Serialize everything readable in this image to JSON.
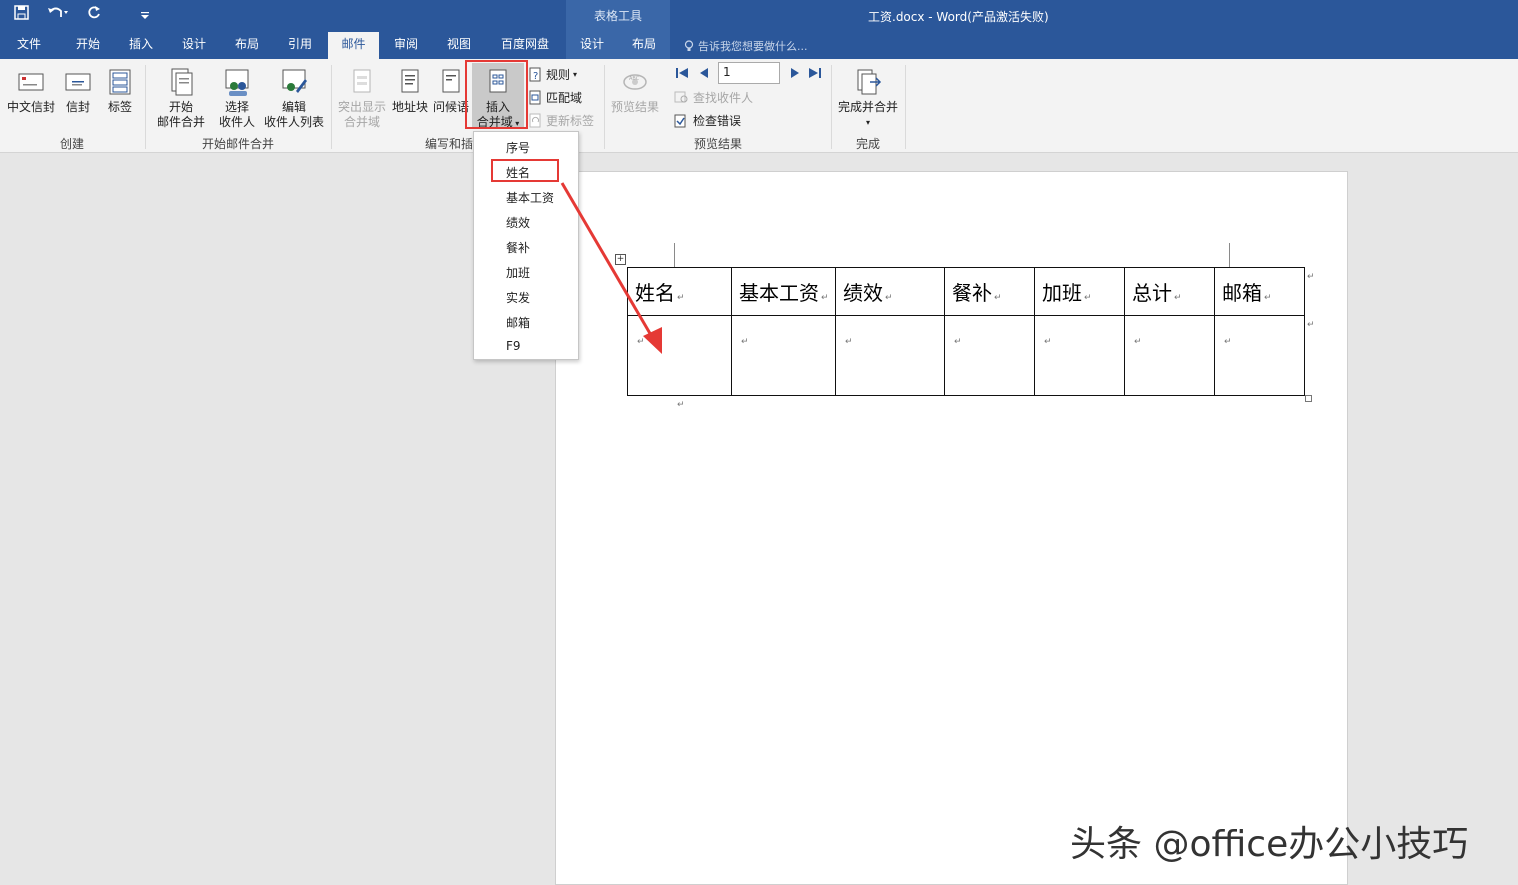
{
  "window": {
    "title": "工资.docx - Word(产品激活失败)",
    "context_tools": "表格工具"
  },
  "qat": {
    "save": "save-icon",
    "undo": "undo-icon",
    "redo": "redo-icon",
    "customize": "customize-icon"
  },
  "tabs": {
    "file": "文件",
    "home": "开始",
    "insert": "插入",
    "design": "设计",
    "layout": "布局",
    "references": "引用",
    "mailings": "邮件",
    "review": "审阅",
    "view": "视图",
    "baidu": "百度网盘",
    "table_design": "设计",
    "table_layout": "布局"
  },
  "tell_me": "告诉我您想要做什么...",
  "ribbon": {
    "create": {
      "label": "创建",
      "chinese_envelope": "中文信封",
      "envelopes": "信封",
      "labels": "标签"
    },
    "start_merge": {
      "label": "开始邮件合并",
      "start_line1": "开始",
      "start_line2": "邮件合并",
      "select_line1": "选择",
      "select_line2": "收件人",
      "edit_line1": "编辑",
      "edit_line2": "收件人列表"
    },
    "write_insert": {
      "label": "编写和插",
      "highlight_line1": "突出显示",
      "highlight_line2": "合并域",
      "address_block": "地址块",
      "greeting": "问候语",
      "insert_line1": "插入",
      "insert_line2": "合并域",
      "rules": "规则",
      "match_fields": "匹配域",
      "update_labels": "更新标签"
    },
    "preview": {
      "label": "预览结果",
      "preview_results": "预览结果",
      "record": "1",
      "find_recipient": "查找收件人",
      "check_errors": "检查错误"
    },
    "finish": {
      "label": "完成",
      "finish_merge": "完成并合并"
    }
  },
  "dropdown": {
    "items": [
      "序号",
      "姓名",
      "基本工资",
      "绩效",
      "餐补",
      "加班",
      "实发",
      "邮箱",
      "F9"
    ]
  },
  "table": {
    "headers": [
      "姓名",
      "基本工资",
      "绩效",
      "餐补",
      "加班",
      "总计",
      "邮箱"
    ],
    "mark": "↵"
  },
  "accent": {
    "ribbon_blue": "#2b579a",
    "highlight_red": "#e53935"
  },
  "watermark": "头条 @office办公小技巧"
}
